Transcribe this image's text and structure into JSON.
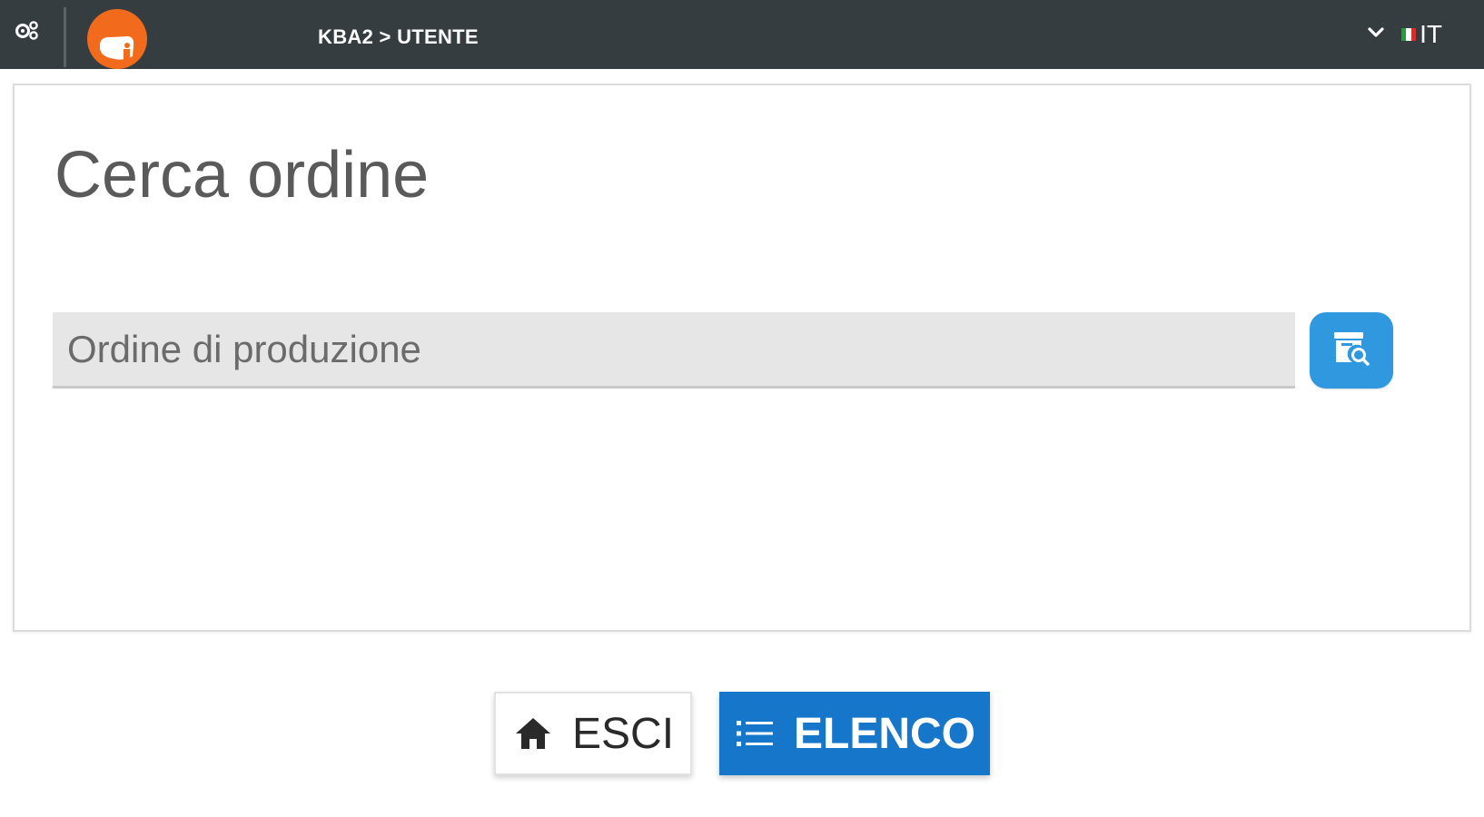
{
  "header": {
    "breadcrumb": "KBA2 > UTENTE",
    "language": {
      "code": "IT",
      "flag_colors": [
        "#1f9e3a",
        "#ffffff",
        "#d32f2f"
      ]
    },
    "icons": {
      "settings": "gears-icon",
      "logo": "app-logo",
      "dropdown": "chevron-down-icon"
    }
  },
  "main": {
    "title": "Cerca ordine",
    "search": {
      "placeholder": "Ordine di produzione",
      "value": "",
      "button_icon": "archive-search-icon"
    }
  },
  "footer": {
    "exit_button": {
      "label": "ESCI",
      "icon": "home-icon"
    },
    "list_button": {
      "label": "ELENCO",
      "icon": "list-icon"
    }
  },
  "colors": {
    "topbar": "#363d41",
    "accent_blue": "#1676c9",
    "search_button": "#2f98df",
    "logo_orange": "#f26a1b"
  }
}
